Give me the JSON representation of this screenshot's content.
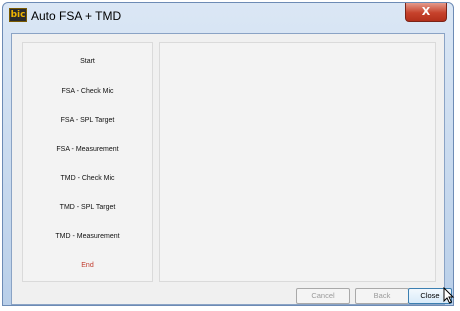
{
  "window": {
    "title": "Auto FSA + TMD",
    "icon_text": "bic",
    "close_glyph": "X"
  },
  "steps": [
    {
      "label": "Start"
    },
    {
      "label": "FSA - Check Mic"
    },
    {
      "label": "FSA - SPL Target"
    },
    {
      "label": "FSA - Measurement"
    },
    {
      "label": "TMD - Check Mic"
    },
    {
      "label": "TMD - SPL Target"
    },
    {
      "label": "TMD - Measurement"
    },
    {
      "label": "End",
      "highlight": true
    }
  ],
  "buttons": {
    "cancel": "Cancel",
    "back": "Back",
    "close": "Close"
  },
  "colors": {
    "end_step": "#c0392b",
    "close_accent": "#3c7fb1"
  }
}
